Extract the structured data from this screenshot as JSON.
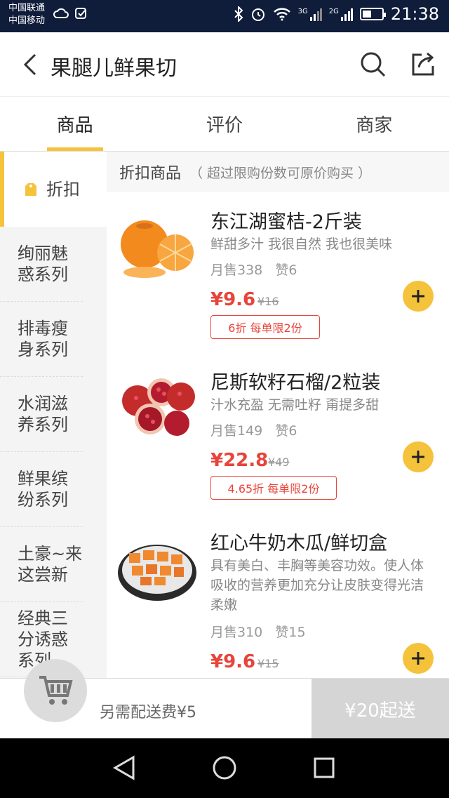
{
  "status_bar": {
    "carrier_1": "中国联通",
    "carrier_2": "中国移动",
    "net_3g": "3G",
    "net_2g": "2G",
    "time": "21:38",
    "battery_level": 0.45
  },
  "header": {
    "title": "果腿儿鲜果切"
  },
  "tabs": [
    {
      "label": "商品",
      "active": true
    },
    {
      "label": "评价",
      "active": false
    },
    {
      "label": "商家",
      "active": false
    }
  ],
  "sidebar": {
    "items": [
      {
        "label": "折扣",
        "active": true
      },
      {
        "label": "绚丽魅惑系列"
      },
      {
        "label": "排毒瘦身系列"
      },
      {
        "label": "水润滋养系列"
      },
      {
        "label": "鲜果缤纷系列"
      },
      {
        "label": "土豪~来这尝新"
      },
      {
        "label": "经典三分诱惑系列"
      }
    ]
  },
  "section": {
    "title": "折扣商品",
    "note": "（ 超过限购份数可原价购买 ）"
  },
  "products": [
    {
      "name": "东江湖蜜桔-2斤装",
      "desc": "鲜甜多汁 我很自然 我也很美味",
      "sales": "月售338",
      "likes": "赞6",
      "price": "¥9.6",
      "orig_price": "¥16",
      "promo": "6折 每单限2份"
    },
    {
      "name": "尼斯软籽石榴/2粒装",
      "desc": "汁水充盈 无需吐籽  甭提多甜",
      "sales": "月售149",
      "likes": "赞6",
      "price": "¥22.8",
      "orig_price": "¥49",
      "promo": "4.65折 每单限2份"
    },
    {
      "name": "红心牛奶木瓜/鲜切盒",
      "desc": "具有美白、丰胸等美容功效。使人体吸收的营养更加充分让皮肤变得光洁柔嫩",
      "sales": "月售310",
      "likes": "赞15",
      "price": "¥9.6",
      "orig_price": "¥15",
      "promo": ""
    }
  ],
  "cart": {
    "fee_text": "另需配送费¥5",
    "min_order": "¥20起送"
  },
  "colors": {
    "accent": "#f5c33b",
    "price": "#e8443a",
    "status_bar": "#0f1c3a"
  }
}
